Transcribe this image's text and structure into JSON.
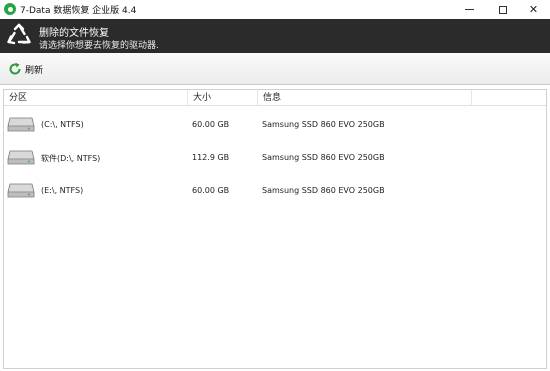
{
  "window": {
    "title": "7-Data 数据恢复 企业版 4.4",
    "icon": "app-logo-icon",
    "controls": [
      "minimize-icon",
      "maximize-icon",
      "close-icon"
    ]
  },
  "banner": {
    "icon": "recycle-icon",
    "title": "删除的文件恢复",
    "subtitle": "请选择你想要去恢复的驱动器."
  },
  "toolbar": {
    "refresh_icon": "refresh-icon",
    "refresh_label": "刷新"
  },
  "table": {
    "columns": [
      "分区",
      "大小",
      "信息"
    ],
    "rows": [
      {
        "name": "(C:\\, NTFS)",
        "size": "60.00 GB",
        "info": "Samsung SSD 860 EVO 250GB",
        "icon": "hard-drive-icon"
      },
      {
        "name": "软件(D:\\, NTFS)",
        "size": "112.9 GB",
        "info": "Samsung SSD 860 EVO 250GB",
        "icon": "hard-drive-icon"
      },
      {
        "name": "(E:\\, NTFS)",
        "size": "60.00 GB",
        "info": "Samsung SSD 860 EVO 250GB",
        "icon": "hard-drive-icon"
      }
    ]
  },
  "colors": {
    "banner_bg": "#2b2b2b",
    "accent_green": "#27a545"
  }
}
